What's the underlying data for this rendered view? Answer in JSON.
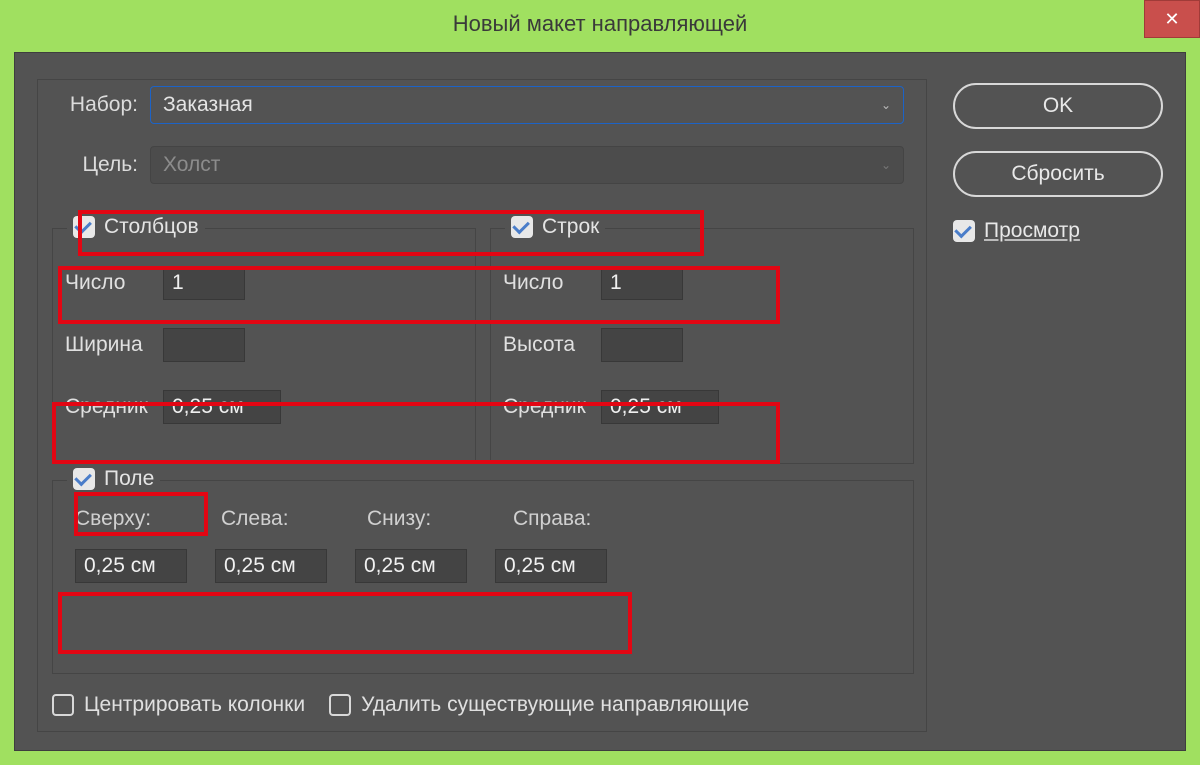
{
  "window": {
    "title": "Новый макет направляющей"
  },
  "labels": {
    "preset": "Набор:",
    "target": "Цель:",
    "columns": "Столбцов",
    "rows": "Строк",
    "number": "Число",
    "width": "Ширина",
    "height": "Высота",
    "gutter": "Средник",
    "margin": "Поле",
    "top": "Сверху:",
    "left": "Слева:",
    "bottom": "Снизу:",
    "right": "Справа:",
    "center_cols": "Центрировать колонки",
    "clear_guides": "Удалить существующие направляющие"
  },
  "values": {
    "preset": "Заказная",
    "target": "Холст",
    "columns_number": "1",
    "columns_width": "",
    "columns_gutter": "0,25 см",
    "rows_number": "1",
    "rows_height": "",
    "rows_gutter": "0,25 см",
    "margin_top": "0,25 см",
    "margin_left": "0,25 см",
    "margin_bottom": "0,25 см",
    "margin_right": "0,25 см"
  },
  "checkboxes": {
    "columns": true,
    "rows": true,
    "margin": true,
    "preview": true,
    "center_cols": false,
    "clear_guides": false
  },
  "buttons": {
    "ok": "OK",
    "reset": "Сбросить",
    "close": "✕"
  },
  "preview_label": "Просмотр"
}
